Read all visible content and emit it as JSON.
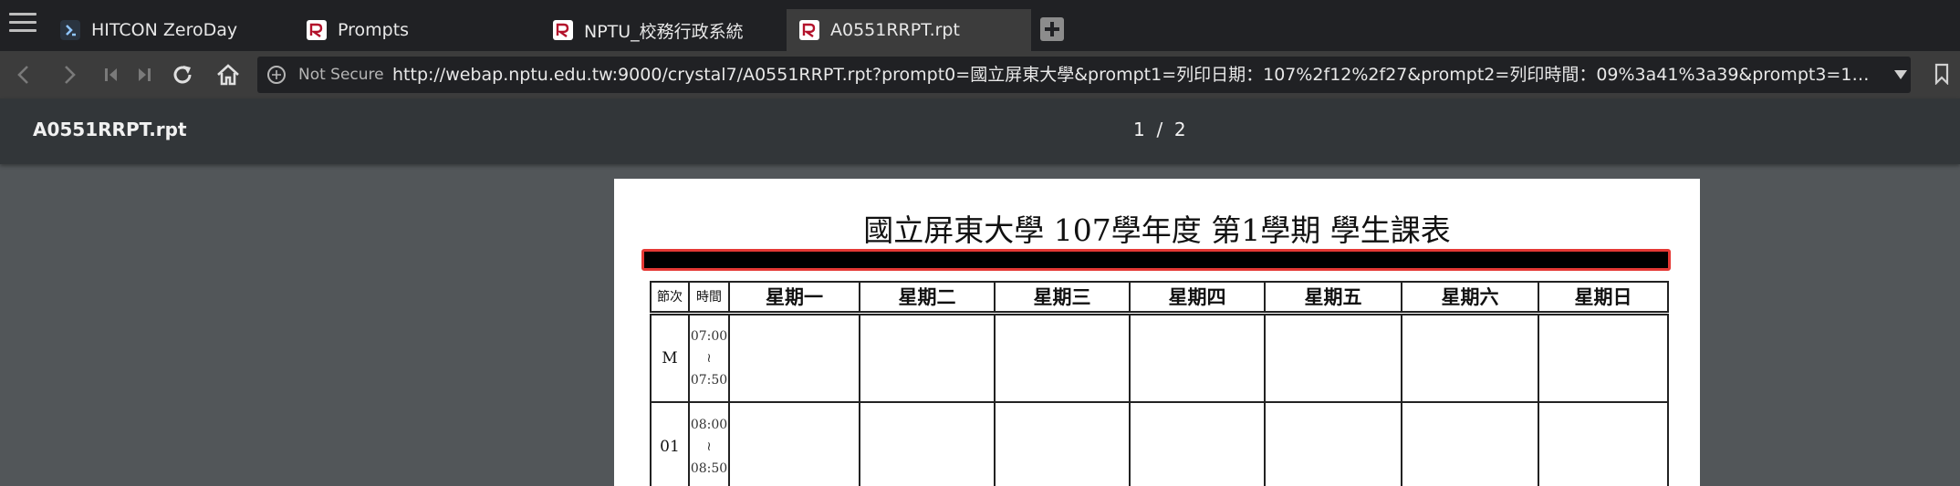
{
  "browser": {
    "tabs": [
      {
        "label": "HITCON ZeroDay",
        "active": false
      },
      {
        "label": "Prompts",
        "active": false
      },
      {
        "label": "NPTU_校務行政系統",
        "active": false
      },
      {
        "label": "A0551RRPT.rpt",
        "active": true
      }
    ],
    "security_label": "Not Secure",
    "url": "http://webap.nptu.edu.tw:9000/crystal7/A0551RRPT.rpt?prompt0=國立屏東大學&prompt1=列印日期：107%2f12%2f27&prompt2=列印時間：09%3a41%3a39&prompt3=107學年度+第1學..."
  },
  "viewer": {
    "file_name": "A0551RRPT.rpt",
    "page_indicator": "1  /  2"
  },
  "document": {
    "title": "國立屏東大學 107學年度 第1學期 學生課表",
    "table": {
      "headers": [
        "節次",
        "時間",
        "星期一",
        "星期二",
        "星期三",
        "星期四",
        "星期五",
        "星期六",
        "星期日"
      ],
      "rows": [
        {
          "period": "M",
          "start": "07:00",
          "sep": "≀",
          "end": "07:50"
        },
        {
          "period": "01",
          "start": "08:00",
          "sep": "≀",
          "end": "08:50"
        }
      ]
    }
  },
  "colors": {
    "tab_bar": "#202124",
    "toolbar": "#3c3c3c",
    "viewer_bar": "#323639",
    "viewer_background": "#525659",
    "redaction_border": "#e53935"
  },
  "icons": [
    "menu-icon",
    "zeroday-favicon",
    "nptu-favicon",
    "new-tab-icon",
    "back-icon",
    "forward-icon",
    "first-page-icon",
    "last-page-icon",
    "reload-icon",
    "home-icon",
    "info-icon",
    "dropdown-icon",
    "bookmark-icon"
  ]
}
